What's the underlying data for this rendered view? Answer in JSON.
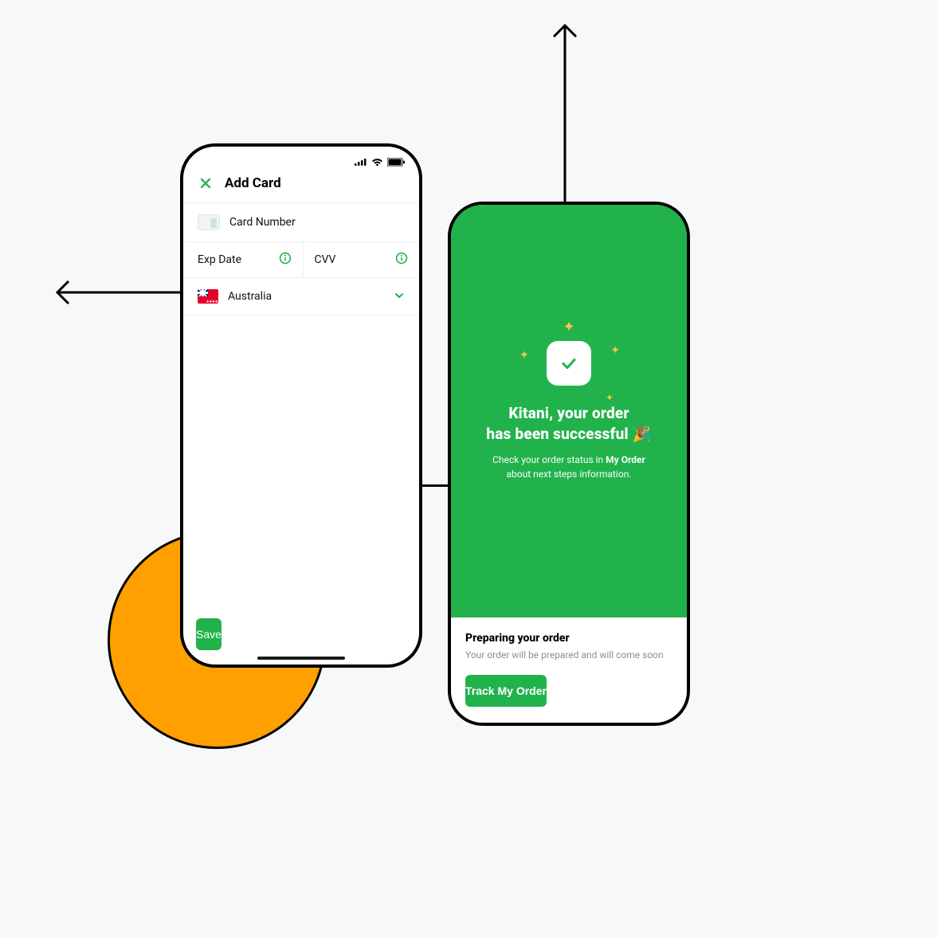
{
  "colors": {
    "accent": "#22b24c",
    "orange": "#ffa000",
    "muted": "#8a8f95"
  },
  "phone1": {
    "header": {
      "title": "Add Card"
    },
    "fields": {
      "card_number_placeholder": "Card Number",
      "exp_date_placeholder": "Exp Date",
      "cvv_placeholder": "CVV",
      "country_selected": "Australia"
    },
    "buttons": {
      "save": "Save"
    }
  },
  "phone2": {
    "success": {
      "title_line1": "Kitani, your order",
      "title_line2": "has been successful 🎉",
      "subtitle_prefix": "Check your order status in ",
      "subtitle_bold": "My Order",
      "subtitle_suffix": " about next steps information."
    },
    "footer": {
      "heading": "Preparing your order",
      "subtitle": "Your order will be prepared and will come soon",
      "track_button": "Track My Order"
    }
  }
}
